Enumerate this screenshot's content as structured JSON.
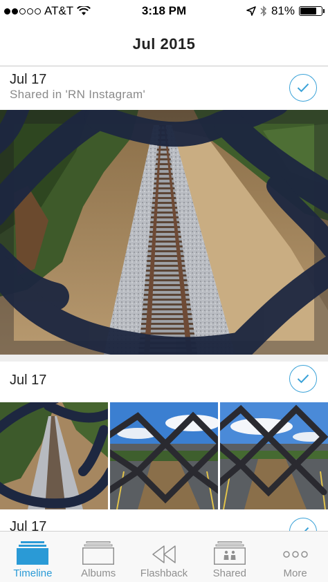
{
  "status_bar": {
    "carrier": "AT&T",
    "time": "3:18 PM",
    "battery": "81%",
    "battery_level": 0.81,
    "signal_bars_filled": 2,
    "signal_bars_total": 5
  },
  "header": {
    "title": "Jul 2015"
  },
  "groups": [
    {
      "date": "Jul 17",
      "subtitle": "Shared in 'RN Instagram'"
    },
    {
      "date": "Jul 17"
    },
    {
      "date": "Jul 17"
    }
  ],
  "tabs": [
    {
      "label": "Timeline",
      "icon": "timeline-icon",
      "active": true
    },
    {
      "label": "Albums",
      "icon": "albums-icon"
    },
    {
      "label": "Flashback",
      "icon": "flashback-icon"
    },
    {
      "label": "Shared",
      "icon": "shared-icon"
    },
    {
      "label": "More",
      "icon": "more-icon"
    }
  ],
  "colors": {
    "accent": "#2a9ad6",
    "check": "#3aa2d8",
    "inactive_tab": "#8f8f8f"
  }
}
